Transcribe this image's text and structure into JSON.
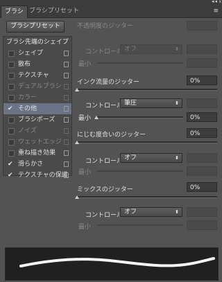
{
  "tabs": {
    "brush": "ブラシ",
    "brush_preset": "ブラシプリセット",
    "menu_icon": "≡"
  },
  "window": {
    "collapse_icon": "◂◂",
    "close_icon": "x"
  },
  "preset_button": "ブラシプリセット",
  "left": {
    "header": "ブラシ先端のシェイプ",
    "items": [
      {
        "label": "シェイプ",
        "checked": false,
        "enabled": true
      },
      {
        "label": "散布",
        "checked": false,
        "enabled": true
      },
      {
        "label": "テクスチャ",
        "checked": false,
        "enabled": true
      },
      {
        "label": "デュアルブラシ",
        "checked": false,
        "enabled": false
      },
      {
        "label": "カラー",
        "checked": false,
        "enabled": false
      },
      {
        "label": "その他",
        "checked": true,
        "enabled": true,
        "selected": true
      },
      {
        "label": "ブラシポーズ",
        "checked": false,
        "enabled": true
      },
      {
        "label": "ノイズ",
        "checked": false,
        "enabled": false
      },
      {
        "label": "ウェットエッジ",
        "checked": false,
        "enabled": false
      },
      {
        "label": "重ね描き効果",
        "checked": false,
        "enabled": true
      },
      {
        "label": "滑らかさ",
        "checked": true,
        "enabled": true
      },
      {
        "label": "テクスチャの保護",
        "checked": true,
        "enabled": true
      }
    ]
  },
  "opacity_jitter": {
    "label": "不透明度のジッター",
    "value": "",
    "control_label": "コントロール :",
    "control_value": "オフ",
    "min_label": "最小",
    "min_value": ""
  },
  "flow_jitter": {
    "label": "インク流量のジッター",
    "value": "0%",
    "control_label": "コントロール :",
    "control_value": "筆圧",
    "min_label": "最小",
    "min_value": "0%"
  },
  "wetness_jitter": {
    "label": "にじむ度合いのジッター",
    "value": "0%",
    "control_label": "コントロール :",
    "control_value": "オフ",
    "min_label": "最小",
    "min_value": ""
  },
  "mix_jitter": {
    "label": "ミックスのジッター",
    "value": "0%",
    "control_label": "コントロール :",
    "control_value": "オフ",
    "min_label": "最小",
    "min_value": ""
  }
}
